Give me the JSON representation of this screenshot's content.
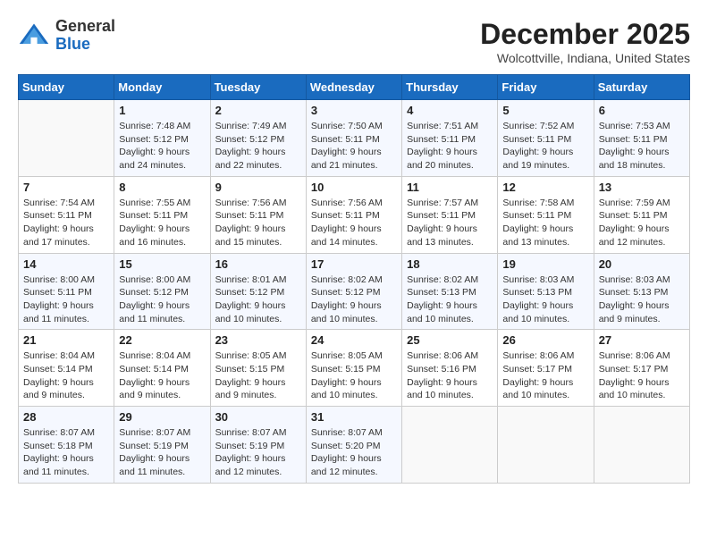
{
  "header": {
    "logo_general": "General",
    "logo_blue": "Blue",
    "month": "December 2025",
    "location": "Wolcottville, Indiana, United States"
  },
  "days_of_week": [
    "Sunday",
    "Monday",
    "Tuesday",
    "Wednesday",
    "Thursday",
    "Friday",
    "Saturday"
  ],
  "weeks": [
    [
      {
        "day": "",
        "info": ""
      },
      {
        "day": "1",
        "info": "Sunrise: 7:48 AM\nSunset: 5:12 PM\nDaylight: 9 hours\nand 24 minutes."
      },
      {
        "day": "2",
        "info": "Sunrise: 7:49 AM\nSunset: 5:12 PM\nDaylight: 9 hours\nand 22 minutes."
      },
      {
        "day": "3",
        "info": "Sunrise: 7:50 AM\nSunset: 5:11 PM\nDaylight: 9 hours\nand 21 minutes."
      },
      {
        "day": "4",
        "info": "Sunrise: 7:51 AM\nSunset: 5:11 PM\nDaylight: 9 hours\nand 20 minutes."
      },
      {
        "day": "5",
        "info": "Sunrise: 7:52 AM\nSunset: 5:11 PM\nDaylight: 9 hours\nand 19 minutes."
      },
      {
        "day": "6",
        "info": "Sunrise: 7:53 AM\nSunset: 5:11 PM\nDaylight: 9 hours\nand 18 minutes."
      }
    ],
    [
      {
        "day": "7",
        "info": "Sunrise: 7:54 AM\nSunset: 5:11 PM\nDaylight: 9 hours\nand 17 minutes."
      },
      {
        "day": "8",
        "info": "Sunrise: 7:55 AM\nSunset: 5:11 PM\nDaylight: 9 hours\nand 16 minutes."
      },
      {
        "day": "9",
        "info": "Sunrise: 7:56 AM\nSunset: 5:11 PM\nDaylight: 9 hours\nand 15 minutes."
      },
      {
        "day": "10",
        "info": "Sunrise: 7:56 AM\nSunset: 5:11 PM\nDaylight: 9 hours\nand 14 minutes."
      },
      {
        "day": "11",
        "info": "Sunrise: 7:57 AM\nSunset: 5:11 PM\nDaylight: 9 hours\nand 13 minutes."
      },
      {
        "day": "12",
        "info": "Sunrise: 7:58 AM\nSunset: 5:11 PM\nDaylight: 9 hours\nand 13 minutes."
      },
      {
        "day": "13",
        "info": "Sunrise: 7:59 AM\nSunset: 5:11 PM\nDaylight: 9 hours\nand 12 minutes."
      }
    ],
    [
      {
        "day": "14",
        "info": "Sunrise: 8:00 AM\nSunset: 5:11 PM\nDaylight: 9 hours\nand 11 minutes."
      },
      {
        "day": "15",
        "info": "Sunrise: 8:00 AM\nSunset: 5:12 PM\nDaylight: 9 hours\nand 11 minutes."
      },
      {
        "day": "16",
        "info": "Sunrise: 8:01 AM\nSunset: 5:12 PM\nDaylight: 9 hours\nand 10 minutes."
      },
      {
        "day": "17",
        "info": "Sunrise: 8:02 AM\nSunset: 5:12 PM\nDaylight: 9 hours\nand 10 minutes."
      },
      {
        "day": "18",
        "info": "Sunrise: 8:02 AM\nSunset: 5:13 PM\nDaylight: 9 hours\nand 10 minutes."
      },
      {
        "day": "19",
        "info": "Sunrise: 8:03 AM\nSunset: 5:13 PM\nDaylight: 9 hours\nand 10 minutes."
      },
      {
        "day": "20",
        "info": "Sunrise: 8:03 AM\nSunset: 5:13 PM\nDaylight: 9 hours\nand 9 minutes."
      }
    ],
    [
      {
        "day": "21",
        "info": "Sunrise: 8:04 AM\nSunset: 5:14 PM\nDaylight: 9 hours\nand 9 minutes."
      },
      {
        "day": "22",
        "info": "Sunrise: 8:04 AM\nSunset: 5:14 PM\nDaylight: 9 hours\nand 9 minutes."
      },
      {
        "day": "23",
        "info": "Sunrise: 8:05 AM\nSunset: 5:15 PM\nDaylight: 9 hours\nand 9 minutes."
      },
      {
        "day": "24",
        "info": "Sunrise: 8:05 AM\nSunset: 5:15 PM\nDaylight: 9 hours\nand 10 minutes."
      },
      {
        "day": "25",
        "info": "Sunrise: 8:06 AM\nSunset: 5:16 PM\nDaylight: 9 hours\nand 10 minutes."
      },
      {
        "day": "26",
        "info": "Sunrise: 8:06 AM\nSunset: 5:17 PM\nDaylight: 9 hours\nand 10 minutes."
      },
      {
        "day": "27",
        "info": "Sunrise: 8:06 AM\nSunset: 5:17 PM\nDaylight: 9 hours\nand 10 minutes."
      }
    ],
    [
      {
        "day": "28",
        "info": "Sunrise: 8:07 AM\nSunset: 5:18 PM\nDaylight: 9 hours\nand 11 minutes."
      },
      {
        "day": "29",
        "info": "Sunrise: 8:07 AM\nSunset: 5:19 PM\nDaylight: 9 hours\nand 11 minutes."
      },
      {
        "day": "30",
        "info": "Sunrise: 8:07 AM\nSunset: 5:19 PM\nDaylight: 9 hours\nand 12 minutes."
      },
      {
        "day": "31",
        "info": "Sunrise: 8:07 AM\nSunset: 5:20 PM\nDaylight: 9 hours\nand 12 minutes."
      },
      {
        "day": "",
        "info": ""
      },
      {
        "day": "",
        "info": ""
      },
      {
        "day": "",
        "info": ""
      }
    ]
  ]
}
